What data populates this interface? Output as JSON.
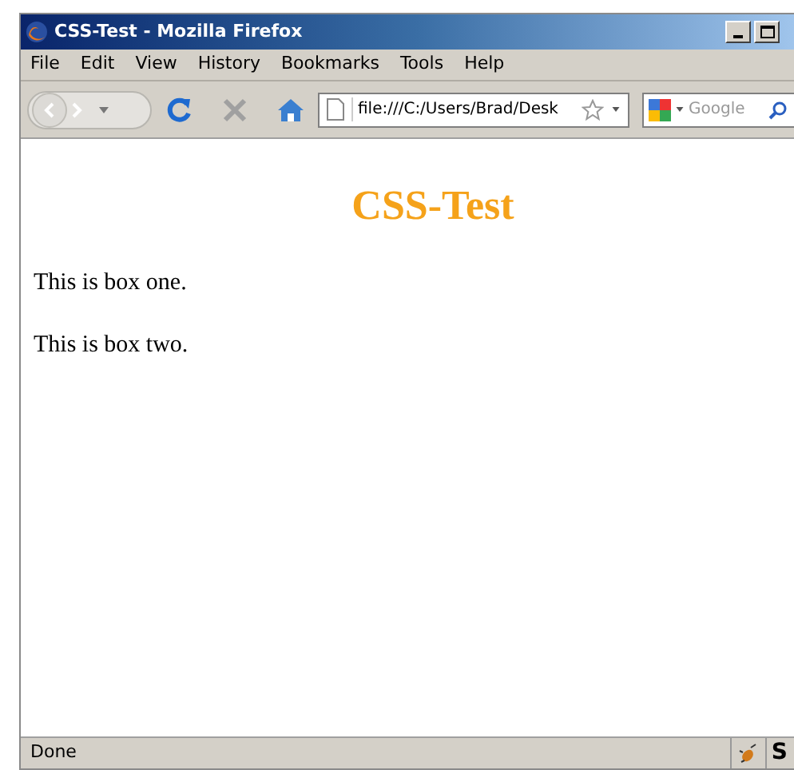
{
  "window": {
    "title": "CSS-Test - Mozilla Firefox"
  },
  "menu": [
    "File",
    "Edit",
    "View",
    "History",
    "Bookmarks",
    "Tools",
    "Help"
  ],
  "address": {
    "value": "file:///C:/Users/Brad/Desk"
  },
  "search": {
    "placeholder": "Google"
  },
  "page": {
    "heading": "CSS-Test",
    "paragraphs": [
      "This is box one.",
      "This is box two."
    ]
  },
  "status_bar": {
    "text": "Done",
    "addon_label": "S"
  }
}
